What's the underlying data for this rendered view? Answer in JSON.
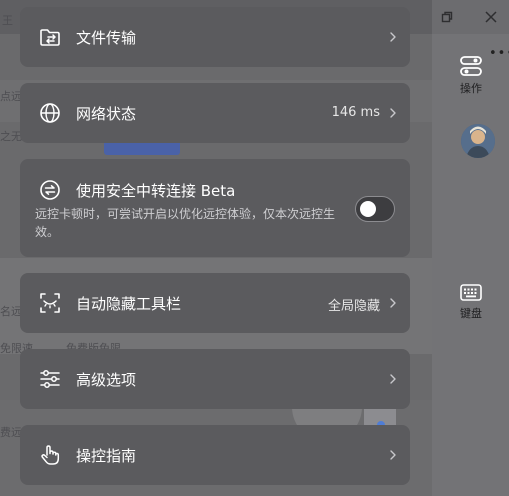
{
  "menu": {
    "file_transfer": {
      "label": "文件传输",
      "icon": "folder-transfer-icon"
    },
    "network_status": {
      "label": "网络状态",
      "value": "146 ms",
      "icon": "globe-icon"
    },
    "secure_relay": {
      "label": "使用安全中转连接 Beta",
      "description": "远控卡顿时，可尝试开启以优化远控体验，仅本次远控生效。",
      "enabled": false,
      "icon": "relay-arrows-icon"
    },
    "auto_hide_toolbar": {
      "label": "自动隐藏工具栏",
      "value": "全局隐藏",
      "icon": "auto-hide-icon"
    },
    "advanced_options": {
      "label": "高级选项",
      "icon": "sliders-icon"
    },
    "control_guide": {
      "label": "操控指南",
      "icon": "hand-pointer-icon"
    }
  },
  "side_toolbar": {
    "operations_label": "操作",
    "keyboard_label": "键盘",
    "more_label": "•••"
  },
  "background": {
    "texts": [
      "王",
      "点远",
      "之无",
      "费远",
      "免限速",
      "免费版免限",
      "名远"
    ]
  },
  "colors": {
    "item_background": "#5b5b5e",
    "overlay_background": "#6d6d70",
    "toggle_off_track": "#3d3d40"
  }
}
